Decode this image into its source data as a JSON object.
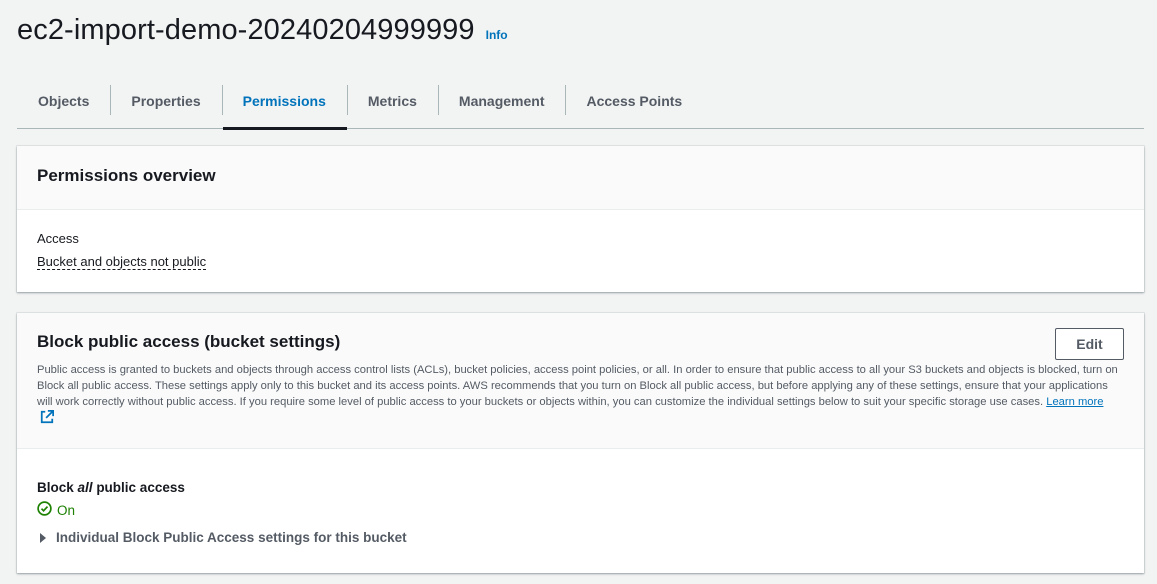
{
  "header": {
    "bucket_name": "ec2-import-demo-20240204999999",
    "info_label": "Info"
  },
  "tabs": [
    {
      "label": "Objects",
      "active": false
    },
    {
      "label": "Properties",
      "active": false
    },
    {
      "label": "Permissions",
      "active": true
    },
    {
      "label": "Metrics",
      "active": false
    },
    {
      "label": "Management",
      "active": false
    },
    {
      "label": "Access Points",
      "active": false
    }
  ],
  "permissions_overview": {
    "title": "Permissions overview",
    "access_label": "Access",
    "access_value": "Bucket and objects not public"
  },
  "block_public_access": {
    "title": "Block public access (bucket settings)",
    "edit_label": "Edit",
    "description": "Public access is granted to buckets and objects through access control lists (ACLs), bucket policies, access point policies, or all. In order to ensure that public access to all your S3 buckets and objects is blocked, turn on Block all public access. These settings apply only to this bucket and its access points. AWS recommends that you turn on Block all public access, but before applying any of these settings, ensure that your applications will work correctly without public access. If you require some level of public access to your buckets or objects within, you can customize the individual settings below to suit your specific storage use cases.",
    "learn_more_label": "Learn more",
    "block_all_prefix": "Block",
    "block_all_emphasis": "all",
    "block_all_suffix": "public access",
    "status_value": "On",
    "individual_settings_label": "Individual Block Public Access settings for this bucket"
  },
  "icons": {
    "status": "check-circle-icon",
    "external_link": "external-link-icon",
    "expander": "caret-right-icon"
  },
  "colors": {
    "link": "#0073bb",
    "success": "#1d8102",
    "text": "#16191f",
    "secondary_text": "#545b64",
    "page_background": "#f2f3f3"
  }
}
